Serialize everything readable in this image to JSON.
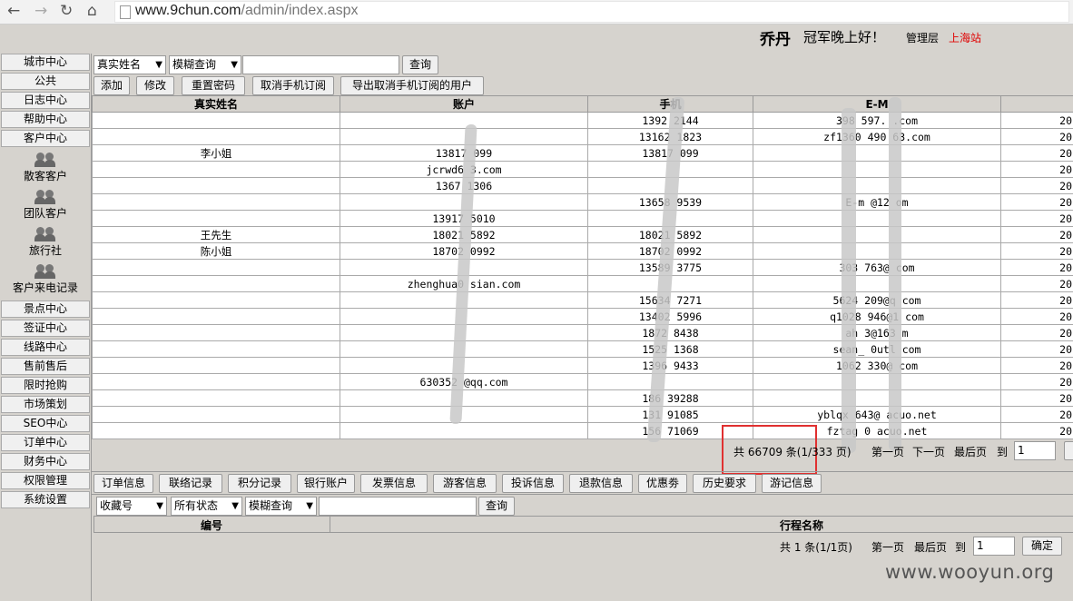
{
  "browser": {
    "url_host": "www.9chun.com",
    "url_path": "/admin/index.aspx"
  },
  "header": {
    "user": "乔丹",
    "greeting": "冠军晚上好！",
    "role": "管理层",
    "station": "上海站"
  },
  "sidebar": {
    "top": [
      "城市中心",
      "公共",
      "日志中心",
      "帮助中心",
      "客户中心"
    ],
    "sub": [
      "散客客户",
      "团队客户",
      "旅行社",
      "客户来电记录"
    ],
    "bottom": [
      "景点中心",
      "签证中心",
      "线路中心",
      "售前售后",
      "限时抢购",
      "市场策划",
      "SEO中心",
      "订单中心",
      "财务中心",
      "权限管理",
      "系统设置"
    ]
  },
  "search": {
    "field": "真实姓名",
    "mode": "模糊查询",
    "value": "",
    "button": "查询"
  },
  "toolbar": [
    "添加",
    "修改",
    "重置密码",
    "取消手机订阅",
    "导出取消手机订阅的用户"
  ],
  "table": {
    "columns": [
      "真实姓名",
      "账户",
      "手机",
      "E-M",
      ""
    ],
    "rows": [
      [
        "",
        "",
        "1392  2144",
        "398    597.  .com",
        "20"
      ],
      [
        "",
        "",
        "13162  1823",
        "zf1360   490   63.com",
        "20"
      ],
      [
        "李小姐",
        "13817  099",
        "13817   099",
        "",
        "20"
      ],
      [
        "",
        "jcrwd6   3.com",
        "",
        "",
        "20"
      ],
      [
        "",
        "1367  1306",
        "",
        "",
        "20"
      ],
      [
        "",
        "",
        "13658  9539",
        "E-m   @12  om",
        "20"
      ],
      [
        "",
        "13917  5010",
        "",
        "",
        "20"
      ],
      [
        "王先生",
        "18021  5892",
        "18021  5892",
        "",
        "20"
      ],
      [
        "陈小姐",
        "18702  0992",
        "18702  0992",
        "",
        "20"
      ],
      [
        "",
        "",
        "13589  3775",
        "303    763@  com",
        "20"
      ],
      [
        "",
        "zhenghua0   sian.com",
        "",
        "",
        "20"
      ],
      [
        "",
        "",
        "15634   7271",
        "5624   209@q  com",
        "20"
      ],
      [
        "",
        "",
        "13402  5996",
        "q1028   946@1   com",
        "20"
      ],
      [
        "",
        "",
        "1872   8438",
        "ah   3@163   m",
        "20"
      ],
      [
        "",
        "",
        "1525   1368",
        "sean_   0utl   com",
        "20"
      ],
      [
        "",
        "",
        "1396   9433",
        "1062  330@   com",
        "20"
      ],
      [
        "",
        "630352   @qq.com",
        "",
        "",
        "20"
      ],
      [
        "",
        "",
        "186   39288",
        "",
        "20"
      ],
      [
        "",
        "",
        "131   91085",
        "yblqx   643@  acuo.net",
        "20"
      ],
      [
        "",
        "",
        "156   71069",
        "fztag   0  acuo.net",
        "20"
      ]
    ]
  },
  "pager1": {
    "total": "共 66709 条(1/333  页)",
    "first": "第一页",
    "next": "下一页",
    "last": "最后页",
    "goto": "到",
    "page": "1"
  },
  "tabs": [
    "订单信息",
    "联络记录",
    "积分记录",
    "银行账户",
    "发票信息",
    "游客信息",
    "投诉信息",
    "退款信息",
    "优惠劵",
    "历史要求",
    "游记信息"
  ],
  "search2": {
    "field": "收藏号",
    "status": "所有状态",
    "mode": "模糊查询",
    "value": "",
    "button": "查询"
  },
  "table2": {
    "columns": [
      "编号",
      "行程名称"
    ]
  },
  "pager2": {
    "total": "共 1 条(1/1页)",
    "first": "第一页",
    "last": "最后页",
    "goto": "到",
    "page": "1",
    "confirm": "确定"
  },
  "watermark": "www.wooyun.org"
}
